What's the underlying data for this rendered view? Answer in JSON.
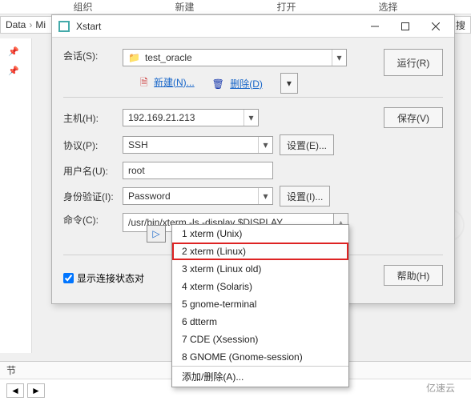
{
  "bg": {
    "toolbar": [
      "组织",
      "新建",
      "打开",
      "选择"
    ],
    "path": {
      "seg1": "Data",
      "seg2_prefix": "Mi",
      "search_btn": "搜"
    },
    "footer_tab": "节",
    "copy": "亿速云"
  },
  "dialog": {
    "title": "Xstart",
    "session": {
      "label": "会话(S):",
      "value": "test_oracle",
      "new": "新建(N)...",
      "delete": "删除(D)",
      "run": "运行(R)"
    },
    "host": {
      "label": "主机(H):",
      "value": "192.169.21.213",
      "save": "保存(V)"
    },
    "proto": {
      "label": "协议(P):",
      "value": "SSH",
      "set": "设置(E)..."
    },
    "user": {
      "label": "用户名(U):",
      "value": "root"
    },
    "auth": {
      "label": "身份验证(I):",
      "value": "Password",
      "set": "设置(I)..."
    },
    "cmd": {
      "label": "命令(C):",
      "value": "/usr/bin/xterm -ls -display $DISPLAY"
    },
    "show_status": "显示连接状态对",
    "help": "帮助(H)"
  },
  "popup": {
    "items": [
      "1 xterm (Unix)",
      "2 xterm (Linux)",
      "3 xterm (Linux old)",
      "4 xterm (Solaris)",
      "5 gnome-terminal",
      "6 dtterm",
      "7 CDE (Xsession)",
      "8 GNOME (Gnome-session)"
    ],
    "footer": "添加/删除(A)..."
  }
}
